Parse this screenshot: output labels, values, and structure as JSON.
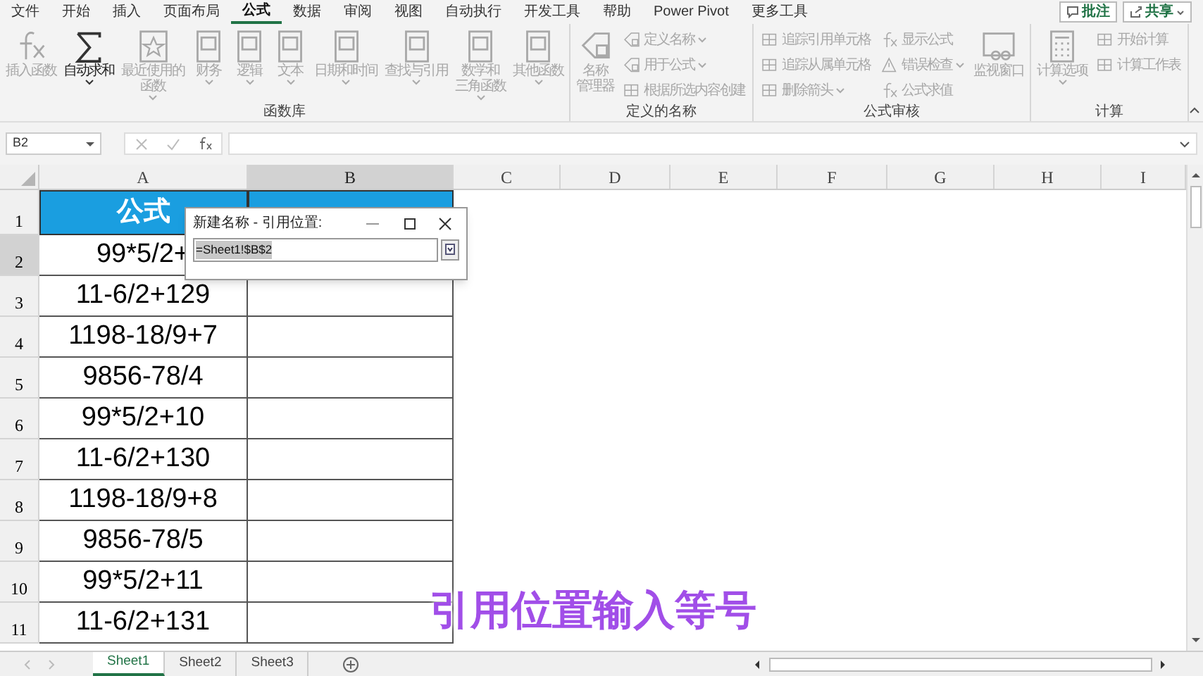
{
  "menu_tabs": [
    {
      "label": "文件",
      "selected": false
    },
    {
      "label": "开始",
      "selected": false
    },
    {
      "label": "插入",
      "selected": false
    },
    {
      "label": "页面布局",
      "selected": false
    },
    {
      "label": "公式",
      "selected": true
    },
    {
      "label": "数据",
      "selected": false
    },
    {
      "label": "审阅",
      "selected": false
    },
    {
      "label": "视图",
      "selected": false
    },
    {
      "label": "自动执行",
      "selected": false
    },
    {
      "label": "开发工具",
      "selected": false
    },
    {
      "label": "帮助",
      "selected": false
    },
    {
      "label": "Power Pivot",
      "selected": false
    },
    {
      "label": "更多工具",
      "selected": false
    }
  ],
  "top_buttons": [
    {
      "label": "批注",
      "kind": "comment"
    },
    {
      "label": "共享",
      "kind": "share"
    }
  ],
  "ribbon_groups": [
    {
      "label": "函数库",
      "items": [
        {
          "lines": [
            "插入函数"
          ],
          "kind": "large",
          "disabled": true,
          "dropdown": false
        },
        {
          "lines": [
            "自动求和"
          ],
          "kind": "large",
          "disabled": false,
          "dropdown": true
        },
        {
          "lines": [
            "最近使用的",
            "函数"
          ],
          "kind": "large",
          "disabled": true,
          "dropdown": true
        },
        {
          "lines": [
            "财务"
          ],
          "kind": "large",
          "disabled": true,
          "dropdown": true
        },
        {
          "lines": [
            "逻辑"
          ],
          "kind": "large",
          "disabled": true,
          "dropdown": true
        },
        {
          "lines": [
            "文本"
          ],
          "kind": "large",
          "disabled": true,
          "dropdown": true
        },
        {
          "lines": [
            "日期和时间"
          ],
          "kind": "large",
          "disabled": true,
          "dropdown": true
        },
        {
          "lines": [
            "查找与引用"
          ],
          "kind": "large",
          "disabled": true,
          "dropdown": true
        },
        {
          "lines": [
            "数学和",
            "三角函数"
          ],
          "kind": "large",
          "disabled": true,
          "dropdown": true
        },
        {
          "lines": [
            "其他函数"
          ],
          "kind": "large",
          "disabled": true,
          "dropdown": true
        }
      ]
    },
    {
      "label": "定义的名称",
      "items": [
        {
          "lines": [
            "名称",
            "管理器"
          ],
          "kind": "large",
          "disabled": true,
          "dropdown": false
        },
        {
          "lines": [
            "定义名称"
          ],
          "kind": "small",
          "disabled": true,
          "dropdown": true
        },
        {
          "lines": [
            "用于公式"
          ],
          "kind": "small",
          "disabled": true,
          "dropdown": true
        },
        {
          "lines": [
            "根据所选内容创建"
          ],
          "kind": "small",
          "disabled": true,
          "dropdown": false
        }
      ]
    },
    {
      "label": "公式审核",
      "items": [
        {
          "lines": [
            "追踪引用单元格"
          ],
          "kind": "small",
          "disabled": true,
          "dropdown": false
        },
        {
          "lines": [
            "追踪从属单元格"
          ],
          "kind": "small",
          "disabled": true,
          "dropdown": false
        },
        {
          "lines": [
            "删除箭头"
          ],
          "kind": "small",
          "disabled": true,
          "dropdown": true
        },
        {
          "lines": [
            "显示公式"
          ],
          "kind": "small",
          "disabled": true,
          "dropdown": false
        },
        {
          "lines": [
            "错误检查"
          ],
          "kind": "small",
          "disabled": true,
          "dropdown": true
        },
        {
          "lines": [
            "公式求值"
          ],
          "kind": "small",
          "disabled": true,
          "dropdown": false
        },
        {
          "lines": [
            "监视窗口"
          ],
          "kind": "large",
          "disabled": true,
          "dropdown": false
        }
      ]
    },
    {
      "label": "计算",
      "items": [
        {
          "lines": [
            "计算选项"
          ],
          "kind": "large",
          "disabled": true,
          "dropdown": true
        },
        {
          "lines": [
            "开始计算"
          ],
          "kind": "small",
          "disabled": true,
          "dropdown": false
        },
        {
          "lines": [
            "计算工作表"
          ],
          "kind": "small",
          "disabled": true,
          "dropdown": false
        }
      ]
    }
  ],
  "name_box": "B2",
  "columns": [
    {
      "label": "A",
      "selected": false
    },
    {
      "label": "B",
      "selected": true
    },
    {
      "label": "C",
      "selected": false
    },
    {
      "label": "D",
      "selected": false
    },
    {
      "label": "E",
      "selected": false
    },
    {
      "label": "F",
      "selected": false
    },
    {
      "label": "G",
      "selected": false
    },
    {
      "label": "H",
      "selected": false
    },
    {
      "label": "I",
      "selected": false
    }
  ],
  "rows": [
    {
      "number": "1",
      "selected": false,
      "cells": [
        "公式",
        ""
      ],
      "kind": "header"
    },
    {
      "number": "2",
      "selected": true,
      "cells": [
        "99*5/2+",
        ""
      ],
      "kind": "data"
    },
    {
      "number": "3",
      "selected": false,
      "cells": [
        "11-6/2+129",
        ""
      ],
      "kind": "data"
    },
    {
      "number": "4",
      "selected": false,
      "cells": [
        "1198-18/9+7",
        ""
      ],
      "kind": "data"
    },
    {
      "number": "5",
      "selected": false,
      "cells": [
        "9856-78/4",
        ""
      ],
      "kind": "data"
    },
    {
      "number": "6",
      "selected": false,
      "cells": [
        "99*5/2+10",
        ""
      ],
      "kind": "data"
    },
    {
      "number": "7",
      "selected": false,
      "cells": [
        "11-6/2+130",
        ""
      ],
      "kind": "data"
    },
    {
      "number": "8",
      "selected": false,
      "cells": [
        "1198-18/9+8",
        ""
      ],
      "kind": "data"
    },
    {
      "number": "9",
      "selected": false,
      "cells": [
        "9856-78/5",
        ""
      ],
      "kind": "data"
    },
    {
      "number": "10",
      "selected": false,
      "cells": [
        "99*5/2+11",
        ""
      ],
      "kind": "data"
    },
    {
      "number": "11",
      "selected": false,
      "cells": [
        "11-6/2+131",
        ""
      ],
      "kind": "data"
    }
  ],
  "dialog": {
    "title": "新建名称 - 引用位置:",
    "value": "=Sheet1!$B$2"
  },
  "caption": "引用位置输入等号",
  "sheet_tabs": [
    {
      "label": "Sheet1",
      "selected": true
    },
    {
      "label": "Sheet2",
      "selected": false
    },
    {
      "label": "Sheet3",
      "selected": false
    }
  ]
}
